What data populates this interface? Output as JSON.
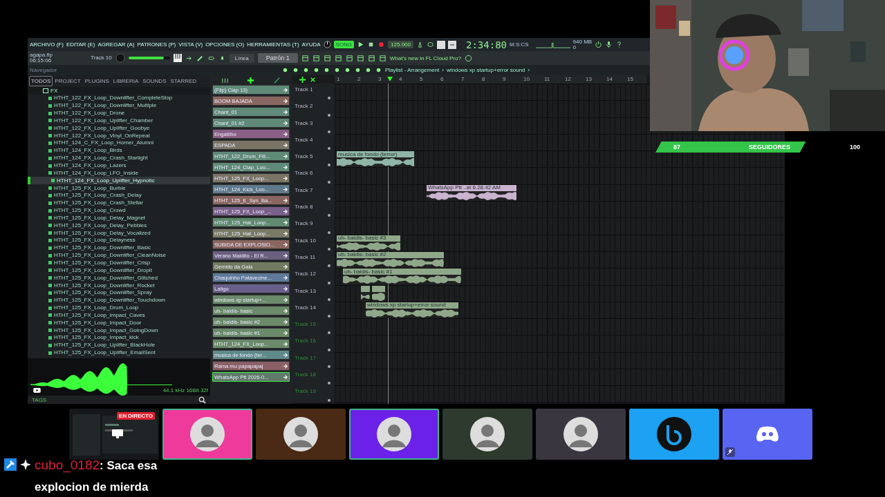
{
  "fl_studio": {
    "menu": [
      "ARCHIVO (F)",
      "EDITAR (E)",
      "AGREGAR (A)",
      "PATRONES (P)",
      "VISTA (V)",
      "OPCIONES (O)",
      "HERRAMIENTAS (T)",
      "AYUDA"
    ],
    "transport": {
      "mode": "SONG",
      "tempo": "125.000",
      "time": "2:34:80",
      "time_unit": "M:S:CS",
      "memory": "940 MB",
      "polyphony": "0"
    },
    "project": {
      "file": "agapa.flp",
      "elapsed": "06:15:06",
      "hint": "Track 10",
      "volume": {
        "level": 0.85
      },
      "snap": "Línea",
      "pattern": "Patrón 1",
      "news": "What's new in FL Cloud Pro?"
    },
    "browser": {
      "hint": "Navegador",
      "tabs": [
        {
          "label": "TODOS",
          "selected": true
        },
        {
          "label": "PROJECT",
          "selected": false
        },
        {
          "label": "PLUGINS",
          "selected": false
        },
        {
          "label": "LIBRERIA",
          "selected": false
        },
        {
          "label": "SOUNDS",
          "selected": false
        },
        {
          "label": "STARRED",
          "selected": false
        }
      ],
      "folder": "FX",
      "files": [
        {
          "name": "HTHT_122_FX_Loop_Downlifter_CompleteStop",
          "selected": false
        },
        {
          "name": "HTHT_122_FX_Loop_Downlifter_Multiple",
          "selected": false
        },
        {
          "name": "HTHT_122_FX_Loop_Drone",
          "selected": false
        },
        {
          "name": "HTHT_122_FX_Loop_Uplifter_Chamber",
          "selected": false
        },
        {
          "name": "HTHT_122_FX_Loop_Uplifter_Goobye",
          "selected": false
        },
        {
          "name": "HTHT_122_FX_Loop_Vinyl_OnRepeat",
          "selected": false
        },
        {
          "name": "HTHT_124_C_FX_Loop_Horner_Alumni",
          "selected": false
        },
        {
          "name": "HTHT_124_FX_Loop_Birds",
          "selected": false
        },
        {
          "name": "HTHT_124_FX_Loop_Crash_Starlight",
          "selected": false
        },
        {
          "name": "HTHT_124_FX_Loop_Lazers",
          "selected": false
        },
        {
          "name": "HTHT_124_FX_Loop_LFO_Inside",
          "selected": false
        },
        {
          "name": "HTHT_124_FX_Loop_Uplifter_Hypnotic",
          "selected": true
        },
        {
          "name": "HTHT_125_FX_Loop_Burble",
          "selected": false
        },
        {
          "name": "HTHT_125_FX_Loop_Crash_Delay",
          "selected": false
        },
        {
          "name": "HTHT_125_FX_Loop_Crash_Stellar",
          "selected": false
        },
        {
          "name": "HTHT_125_FX_Loop_Crowd",
          "selected": false
        },
        {
          "name": "HTHT_125_FX_Loop_Delay_Magnet",
          "selected": false
        },
        {
          "name": "HTHT_125_FX_Loop_Delay_Pebbles",
          "selected": false
        },
        {
          "name": "HTHT_125_FX_Loop_Delay_Vocalized",
          "selected": false
        },
        {
          "name": "HTHT_125_FX_Loop_Delayness",
          "selected": false
        },
        {
          "name": "HTHT_125_FX_Loop_Downlifter_Basic",
          "selected": false
        },
        {
          "name": "HTHT_125_FX_Loop_Downlifter_CleanNoise",
          "selected": false
        },
        {
          "name": "HTHT_125_FX_Loop_Downlifter_Crisp",
          "selected": false
        },
        {
          "name": "HTHT_125_FX_Loop_Downlifter_Dropit",
          "selected": false
        },
        {
          "name": "HTHT_125_FX_Loop_Downlifter_Glitched",
          "selected": false
        },
        {
          "name": "HTHT_125_FX_Loop_Downlifter_Rocket",
          "selected": false
        },
        {
          "name": "HTHT_125_FX_Loop_Downlifter_Spray",
          "selected": false
        },
        {
          "name": "HTHT_125_FX_Loop_Downlifter_Touchdown",
          "selected": false
        },
        {
          "name": "HTHT_125_FX_Loop_Drum_Loop",
          "selected": false
        },
        {
          "name": "HTHT_125_FX_Loop_Impact_Caves",
          "selected": false
        },
        {
          "name": "HTHT_125_FX_Loop_Impact_Door",
          "selected": false
        },
        {
          "name": "HTHT_125_FX_Loop_Impact_GoingDown",
          "selected": false
        },
        {
          "name": "HTHT_125_FX_Loop_Impact_kick",
          "selected": false
        },
        {
          "name": "HTHT_125_FX_Loop_Uplifter_BlackHole",
          "selected": false
        },
        {
          "name": "HTHT_125_FX_Loop_Uplifter_EmailSent",
          "selected": false
        }
      ],
      "preview_info": "44.1 kHz 16Bit 32f",
      "tags_label": "TAGS"
    },
    "channels": [
      {
        "name": "(Flip) Clap 13)",
        "color": "#5f8a78",
        "selected": false
      },
      {
        "name": "BOOM BAJADA",
        "color": "#8a6660",
        "selected": false
      },
      {
        "name": "Chant_01",
        "color": "#5f8a78",
        "selected": false
      },
      {
        "name": "Chant_01 #2",
        "color": "#5f8a78",
        "selected": false
      },
      {
        "name": "Engatilho",
        "color": "#8a5f85",
        "selected": false
      },
      {
        "name": "ESPADA",
        "color": "#7a7466",
        "selected": false
      },
      {
        "name": "HTHT_122_Drum_Fill...",
        "color": "#5f8a78",
        "selected": false
      },
      {
        "name": "HTHT_124_Clap_Loo...",
        "color": "#5f8a78",
        "selected": false
      },
      {
        "name": "HTHT_125_FX_Loop...",
        "color": "#7a7466",
        "selected": false
      },
      {
        "name": "HTHT_124_Kick_Loo...",
        "color": "#5f7a8a",
        "selected": false
      },
      {
        "name": "HTHT_125_E_Syn_Ba...",
        "color": "#8a6660",
        "selected": false
      },
      {
        "name": "HTHT_125_FX_Loop_...",
        "color": "#7a5f8a",
        "selected": false
      },
      {
        "name": "HTHT_125_Hat_Loop...",
        "color": "#5f8a70",
        "selected": false
      },
      {
        "name": "HTHT_125_Hat_Loop...",
        "color": "#7a7a66",
        "selected": false
      },
      {
        "name": "SUBIDA DE EXPLOSIO...",
        "color": "#8a6660",
        "selected": false
      },
      {
        "name": "Verano Maldito - El R...",
        "color": "#6a5f80",
        "selected": false
      },
      {
        "name": "Gemido da Gala",
        "color": "#707a60",
        "selected": false
      },
      {
        "name": "Chaquinho Patavecine...",
        "color": "#5f7a9a",
        "selected": false
      },
      {
        "name": "Latigo",
        "color": "#6a5f8a",
        "selected": false
      },
      {
        "name": "windows xp startup+...",
        "color": "#6a8a6a",
        "selected": false
      },
      {
        "name": "uh- baldis- basic",
        "color": "#6a8a6a",
        "selected": false
      },
      {
        "name": "uh- baldis- basic #2",
        "color": "#6a8a6a",
        "selected": false
      },
      {
        "name": "uh- baldis- basic #1",
        "color": "#6a8a6a",
        "selected": false
      },
      {
        "name": "HTHT_124_FX_Loop...",
        "color": "#6a8a6a",
        "selected": false
      },
      {
        "name": "musica de fondo (ter...",
        "color": "#5f8a8a",
        "selected": false
      },
      {
        "name": "Rama mu papapapaj",
        "color": "#8a5f66",
        "selected": false
      },
      {
        "name": "WhatsApp Ptt 2026-0...",
        "color": "#5f7a6a",
        "selected": true
      }
    ],
    "playlist": {
      "title": "Playlist - Arrangement",
      "separator": "›",
      "pattern": "windows xp startup+error sound",
      "separator_2": "›",
      "ruler": [
        "1",
        "2",
        "3",
        "4",
        "5",
        "6",
        "7",
        "8",
        "9",
        "10",
        "11",
        "12",
        "13",
        "14",
        "15"
      ],
      "tracks": [
        {
          "name": "Track 1",
          "empty": false
        },
        {
          "name": "Track 2",
          "empty": false
        },
        {
          "name": "Track 3",
          "empty": false
        },
        {
          "name": "Track 4",
          "empty": false
        },
        {
          "name": "Track 5",
          "empty": false,
          "clips": [
            {
              "label": "musica de fondo (terror)",
              "color": "#8fb5a5"
            }
          ]
        },
        {
          "name": "Track 6",
          "empty": false
        },
        {
          "name": "Track 7",
          "empty": false,
          "clips": [
            {
              "label": "WhatsApp Ptt ..at 6.28.42 AM",
              "color": "#c9b3cf"
            }
          ]
        },
        {
          "name": "Track 8",
          "empty": false
        },
        {
          "name": "Track 9",
          "empty": false
        },
        {
          "name": "Track 10",
          "empty": false,
          "clips": [
            {
              "label": "uh- baldis- basic #3",
              "color": "#8fa88a"
            }
          ]
        },
        {
          "name": "Track 11",
          "empty": false,
          "clips": [
            {
              "label": "uh- baldis- basic #2",
              "color": "#8fa88a"
            }
          ]
        },
        {
          "name": "Track 12",
          "empty": false,
          "clips": [
            {
              "label": "uh- baldis- basic #1",
              "color": "#8fa88a"
            }
          ]
        },
        {
          "name": "Track 13",
          "empty": false,
          "clips": [
            {
              "color": "#8fa88a"
            },
            {
              "color": "#8fa88a"
            }
          ]
        },
        {
          "name": "Track 14",
          "empty": false,
          "clips": [
            {
              "label": "windows xp startup+error sound",
              "color": "#8fa88a"
            }
          ]
        },
        {
          "name": "Track 15",
          "empty": true
        },
        {
          "name": "Track 16",
          "empty": true
        },
        {
          "name": "Track 17",
          "empty": true
        },
        {
          "name": "Track 18",
          "empty": true
        },
        {
          "name": "Track 19",
          "empty": true
        }
      ]
    }
  },
  "followers": {
    "count": "87",
    "label": "SEGUIDORES",
    "goal": "100",
    "level": 0.87
  },
  "tiles": [
    {
      "kind": "preview",
      "badge": "EN DIRECTO",
      "color": "#1a1d1f",
      "selected": false
    },
    {
      "kind": "avatar",
      "color": "#ee3a9b",
      "selected": true
    },
    {
      "kind": "avatar",
      "color": "#4a2a14",
      "selected": false
    },
    {
      "kind": "avatar",
      "color": "#6b21e8",
      "selected": true
    },
    {
      "kind": "avatar",
      "color": "#2e3a2e",
      "selected": false
    },
    {
      "kind": "avatar",
      "color": "#3a3640",
      "selected": false
    },
    {
      "kind": "logo",
      "color": "#1da1f2",
      "selected": false
    },
    {
      "kind": "chat",
      "color": "#5865f2",
      "selected": false
    }
  ],
  "chat": {
    "user": "cubo_0182",
    "message": ": Saca esa explocion de mierda"
  }
}
